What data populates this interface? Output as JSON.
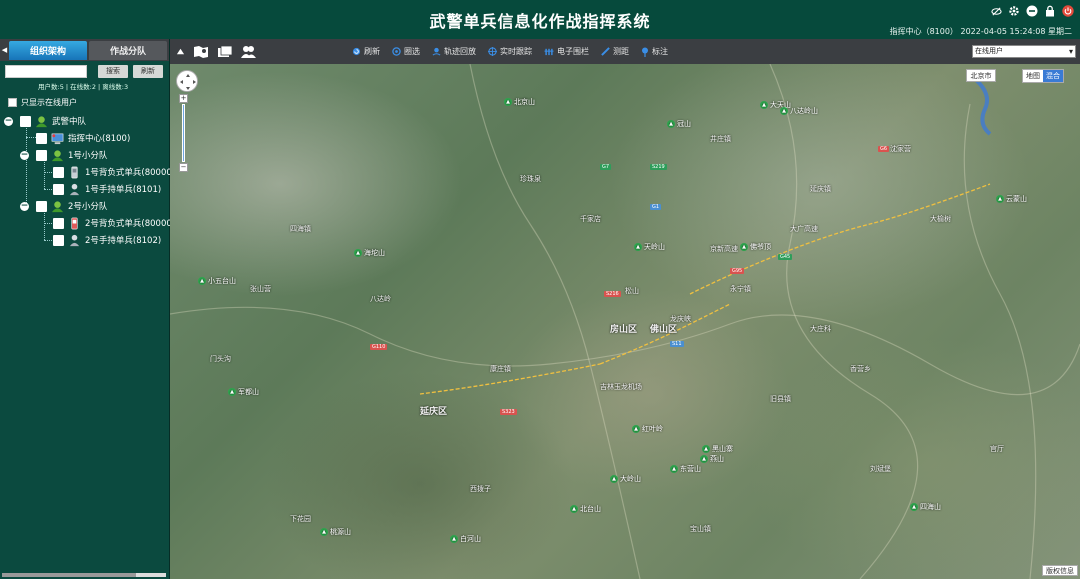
{
  "header": {
    "title": "武警单兵信息化作战指挥系统",
    "status_line": "指挥中心（8100）  2022-04-05 15:24:08 星期二",
    "icons": [
      "eye-off-icon",
      "gear-icon",
      "minus-circle-icon",
      "lock-icon",
      "power-icon"
    ]
  },
  "toolbar": {
    "left_icons": [
      "triangle-up-icon",
      "map-book-icon",
      "cards-icon",
      "users-icon"
    ],
    "buttons": [
      {
        "label": "刷新",
        "icon": "refresh-icon"
      },
      {
        "label": "圈选",
        "icon": "circle-select-icon"
      },
      {
        "label": "轨迹回放",
        "icon": "track-playback-icon"
      },
      {
        "label": "实时跟踪",
        "icon": "realtime-track-icon"
      },
      {
        "label": "电子围栏",
        "icon": "fence-icon"
      },
      {
        "label": "测距",
        "icon": "ruler-icon"
      },
      {
        "label": "标注",
        "icon": "pin-icon"
      }
    ],
    "user_filter": "在线用户"
  },
  "sidebar": {
    "tabs": [
      "组织架构",
      "作战分队"
    ],
    "search_button": "搜索",
    "refresh_button": "刷新",
    "counts": "用户数:5 | 在线数:2 | 离线数:3",
    "only_online_label": "只显示在线用户",
    "tree": [
      {
        "label": "武警中队",
        "level": 0,
        "type": "group"
      },
      {
        "label": "指挥中心(8100)",
        "level": 1,
        "type": "command"
      },
      {
        "label": "1号小分队",
        "level": 1,
        "type": "group"
      },
      {
        "label": "1号背负式单兵(80000",
        "level": 2,
        "type": "backpack"
      },
      {
        "label": "1号手持单兵(8101)",
        "level": 2,
        "type": "handheld"
      },
      {
        "label": "2号小分队",
        "level": 1,
        "type": "group"
      },
      {
        "label": "2号背负式单兵(80000",
        "level": 2,
        "type": "backpack-red"
      },
      {
        "label": "2号手持单兵(8102)",
        "level": 2,
        "type": "handheld"
      }
    ]
  },
  "map": {
    "city": "北京市",
    "map_type_off": "地图",
    "map_type_on": "混合",
    "copyright": "版权信息",
    "labels": [
      {
        "t": "房山区",
        "big": true
      },
      {
        "t": "佛山区",
        "big": true
      },
      {
        "t": "延庆区",
        "big": true
      },
      {
        "t": "吉林玉龙机场",
        "big": false
      },
      {
        "t": "大广高速",
        "big": false
      },
      {
        "t": "京新高速",
        "big": false
      },
      {
        "t": "门头沟",
        "big": false
      },
      {
        "t": "松山",
        "big": false
      },
      {
        "t": "龙庆峡",
        "big": false
      },
      {
        "t": "康庄镇",
        "big": false
      },
      {
        "t": "大庄科",
        "big": false
      },
      {
        "t": "永宁镇",
        "big": false
      },
      {
        "t": "旧县镇",
        "big": false
      },
      {
        "t": "千家店",
        "big": false
      },
      {
        "t": "四海镇",
        "big": false
      },
      {
        "t": "珍珠泉",
        "big": false
      },
      {
        "t": "刘斌堡",
        "big": false
      },
      {
        "t": "香营乡",
        "big": false
      },
      {
        "t": "八达岭",
        "big": false
      },
      {
        "t": "张山营",
        "big": false
      },
      {
        "t": "井庄镇",
        "big": false
      },
      {
        "t": "沈家营",
        "big": false
      },
      {
        "t": "大榆树",
        "big": false
      },
      {
        "t": "延庆镇",
        "big": false
      },
      {
        "t": "西拨子",
        "big": false
      },
      {
        "t": "下花园",
        "big": false
      },
      {
        "t": "官厅",
        "big": false
      },
      {
        "t": "宝山镇",
        "big": false
      }
    ],
    "peaks": [
      "小五台山",
      "海坨山",
      "北京山",
      "佛爷顶",
      "大天山",
      "冠山",
      "天岭山",
      "云蒙山",
      "桃源山",
      "白河山",
      "军都山",
      "红叶岭",
      "大岭山",
      "燕山",
      "东营山",
      "北台山",
      "黑山寨",
      "四海山",
      "八达岭山"
    ],
    "roads_red": [
      "G110",
      "G6",
      "S216",
      "G95",
      "S323"
    ],
    "roads_green": [
      "G7",
      "S219",
      "G45"
    ],
    "roads_blue": [
      "S11",
      "G1"
    ]
  }
}
